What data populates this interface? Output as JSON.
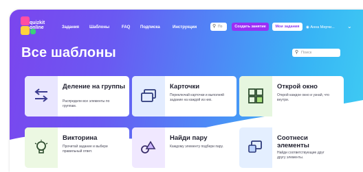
{
  "header": {
    "logo_line1": "quizkit",
    "logo_line2": "online",
    "nav": [
      "Задания",
      "Шаблоны",
      "FAQ",
      "Подписка",
      "Инструкции"
    ],
    "search_placeholder": "По",
    "create_button": "Создать занятие",
    "my_tasks_button": "Мои задания",
    "user_name": "Анна Мерчи..."
  },
  "page": {
    "title": "Все шаблоны",
    "search_placeholder": "Поиск"
  },
  "cards": [
    {
      "title": "Деление на группы",
      "desc": "Распредели все элементы по группам.",
      "icon": "split-arrows-icon",
      "tint": "#e9e6ff"
    },
    {
      "title": "Карточки",
      "desc": "Переключай карточки и выполняй задание на каждой из них.",
      "icon": "cards-stack-icon",
      "tint": "#e3ecff"
    },
    {
      "title": "Открой окно",
      "desc": "Открой каждое окно и узнай, что внутри.",
      "icon": "grid-windows-icon",
      "tint": "#e6f6df"
    },
    {
      "title": "Викторина",
      "desc": "Прочитай задание и выбери правильный ответ.",
      "icon": "lightbulb-icon",
      "tint": "#ecf8e2"
    },
    {
      "title": "Найди пару",
      "desc": "Каждому элементу подбери пару.",
      "icon": "shapes-pair-icon",
      "tint": "#f0e8ff"
    },
    {
      "title": "Соотнеси элементы",
      "desc": "Найди соответствующие друг другу элементы.",
      "icon": "match-items-icon",
      "tint": "#e4efff"
    }
  ],
  "colors": {
    "accent_purple": "#9b2ff5",
    "gradient_start": "#7b45ee",
    "gradient_end": "#3fcdf2"
  }
}
